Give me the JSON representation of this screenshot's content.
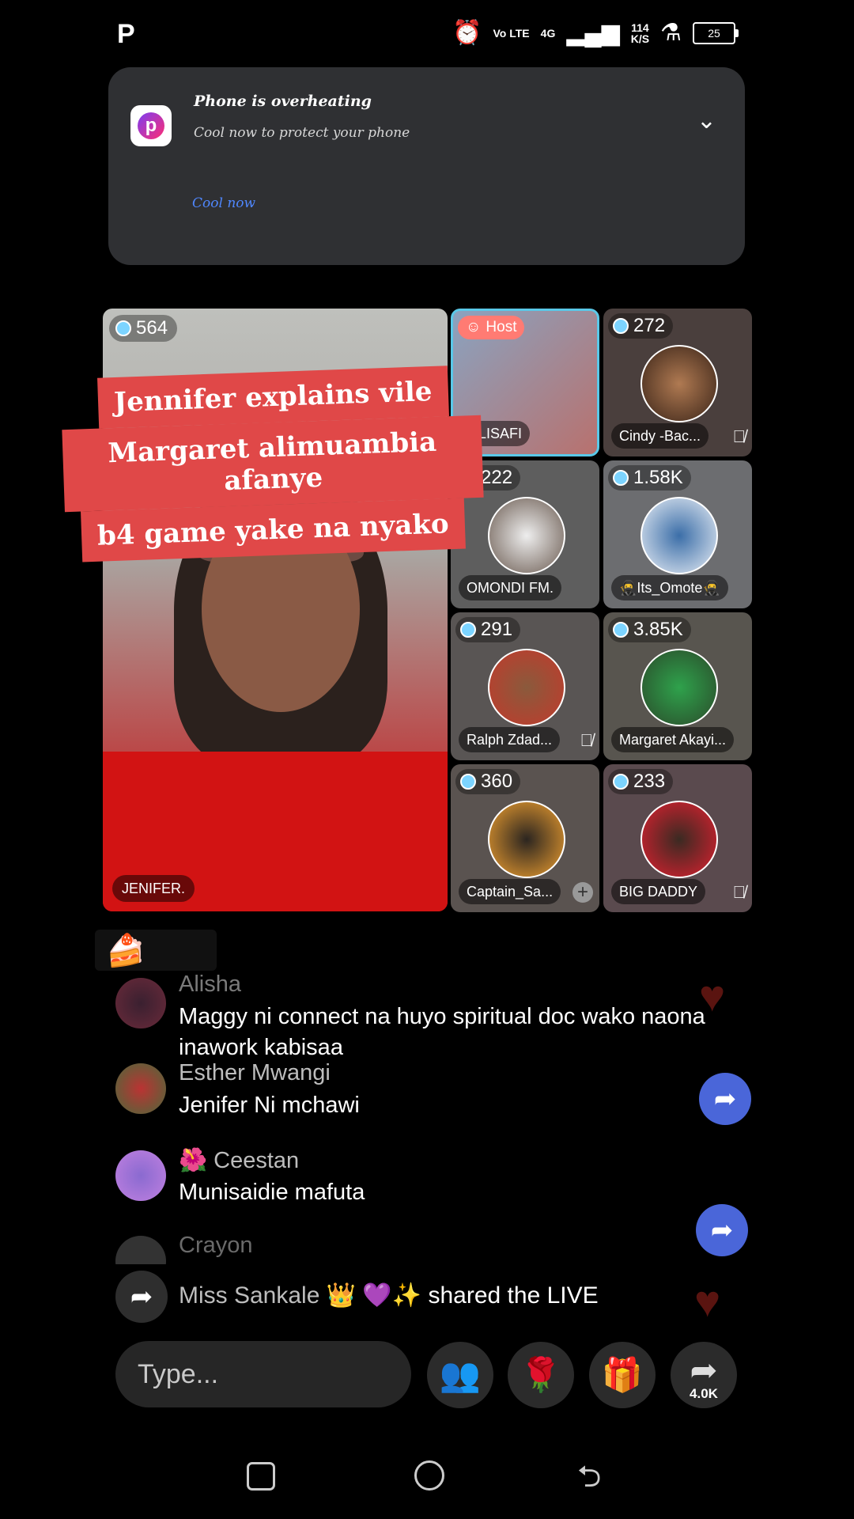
{
  "status_bar": {
    "left_icon": "P",
    "network": "4G",
    "volte": "Vo LTE",
    "speed_value": "114",
    "speed_unit": "K/S",
    "battery": "25"
  },
  "notification": {
    "title": "Phone is overheating",
    "subtitle": "Cool now to protect your phone",
    "action": "Cool now"
  },
  "main_video": {
    "viewer_count": "564",
    "name": "JENIFER.",
    "caption_lines": [
      "Jennifer explains vile",
      "Margaret alimuambia afanye",
      "b4  game yake na nyako"
    ]
  },
  "tiles": [
    {
      "name": "ALISAFI",
      "host_label": "Host",
      "count": "",
      "muted": false
    },
    {
      "name": "Cindy -Bac...",
      "count": "272",
      "muted": true
    },
    {
      "name": "OMONDI FM.",
      "count": "222",
      "muted": false
    },
    {
      "name": "🥷Its_Omote🥷",
      "count": "1.58K",
      "muted": false
    },
    {
      "name": "Ralph Zdad...",
      "count": "291",
      "muted": true
    },
    {
      "name": "Margaret Akayi...",
      "count": "3.85K",
      "muted": false
    },
    {
      "name": "Captain_Sa...",
      "count": "360",
      "muted": false,
      "add": true
    },
    {
      "name": "BIG DADDY",
      "count": "233",
      "muted": true
    }
  ],
  "comments": [
    {
      "user": "Alisha",
      "text": "Maggy ni connect na huyo spiritual doc wako naona inawork kabisaa"
    },
    {
      "user": "Esther Mwangi",
      "text": "Jenifer Ni mchawi"
    },
    {
      "user": "🌺 Ceestan",
      "text": "Munisaidie mafuta"
    },
    {
      "user": "Crayon",
      "text": ""
    }
  ],
  "share_event": {
    "user": "Miss Sankale 👑 💜✨",
    "text": "shared the LIVE"
  },
  "input": {
    "placeholder": "Type..."
  },
  "share_count": "4.0K"
}
